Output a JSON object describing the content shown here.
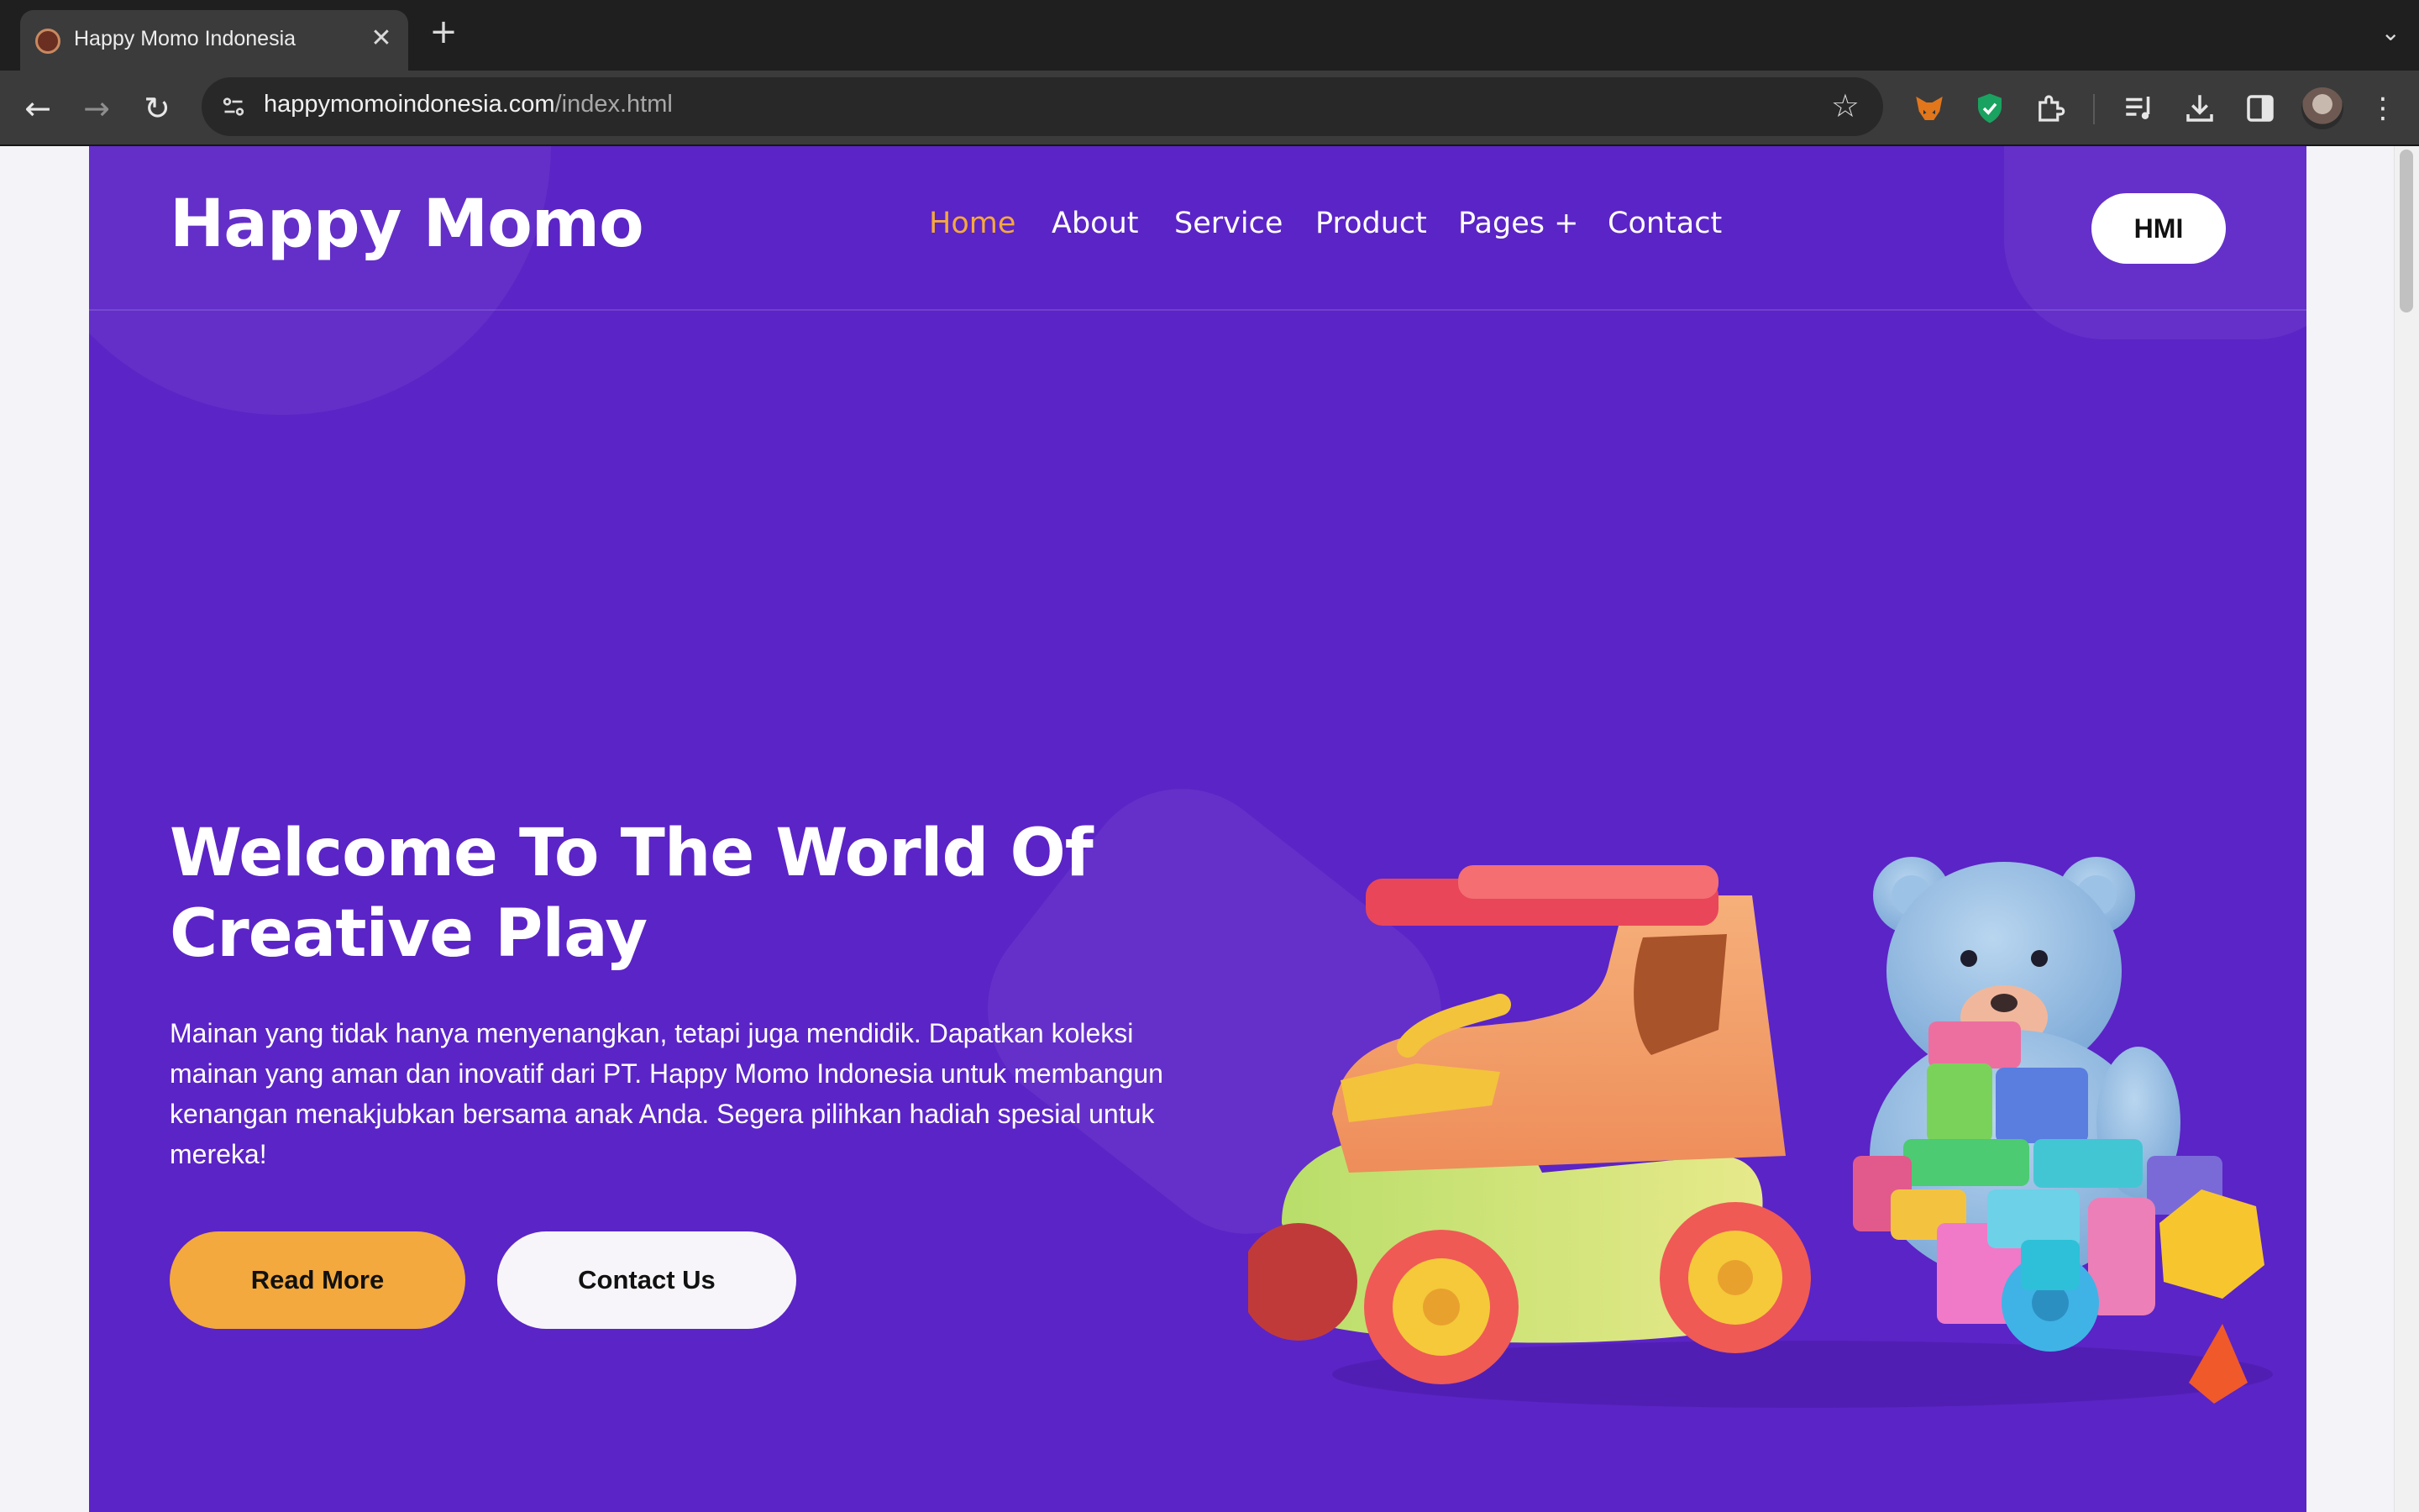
{
  "browser": {
    "tab_title": "Happy Momo Indonesia",
    "url_host": "happymomoindonesia.com",
    "url_path": "/index.html"
  },
  "site": {
    "brand": "Happy Momo",
    "nav": [
      {
        "label": "Home",
        "active": true
      },
      {
        "label": "About"
      },
      {
        "label": "Service"
      },
      {
        "label": "Product"
      },
      {
        "label": "Pages +"
      },
      {
        "label": "Contact"
      }
    ],
    "header_button": "HMI",
    "hero": {
      "title_line1": "Welcome To The World Of",
      "title_line2": "Creative Play",
      "text": "Mainan yang tidak hanya menyenangkan, tetapi juga mendidik. Dapatkan koleksi mainan yang aman dan inovatif dari PT. Happy Momo Indonesia untuk membangun kenangan menakjubkan bersama anak Anda. Segera pilihkan hadiah spesial untuk mereka!",
      "primary_button": "Read More",
      "secondary_button": "Contact Us"
    },
    "colors": {
      "background": "#5b24c6",
      "accent": "#f3a93d",
      "text": "#ffffff"
    }
  },
  "icons": [
    "back-icon",
    "forward-icon",
    "reload-icon",
    "site-info-icon",
    "star-icon",
    "metamask-icon",
    "shield-icon",
    "extensions-icon",
    "media-icon",
    "download-icon",
    "side-panel-icon",
    "menu-icon"
  ]
}
